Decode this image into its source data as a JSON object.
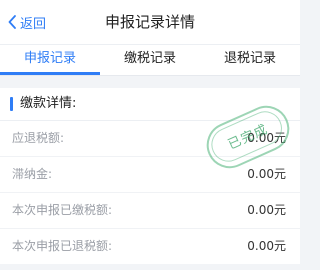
{
  "header": {
    "back_label": "返回",
    "title": "申报记录详情"
  },
  "tabs": [
    {
      "label": "申报记录",
      "active": true
    },
    {
      "label": "缴税记录",
      "active": false
    },
    {
      "label": "退税记录",
      "active": false
    }
  ],
  "details": {
    "section_title": "缴款详情:",
    "rows": [
      {
        "label": "应退税额:",
        "value": "0.00元"
      },
      {
        "label": "滞纳金:",
        "value": "0.00元"
      },
      {
        "label": "本次申报已缴税额:",
        "value": "0.00元"
      },
      {
        "label": "本次申报已退税额:",
        "value": "0.00元"
      }
    ]
  },
  "stamp": {
    "text": "已完成"
  },
  "colors": {
    "accent": "#2f7df6",
    "stamp": "#4cb278",
    "page_bg": "#f2f4f7"
  }
}
